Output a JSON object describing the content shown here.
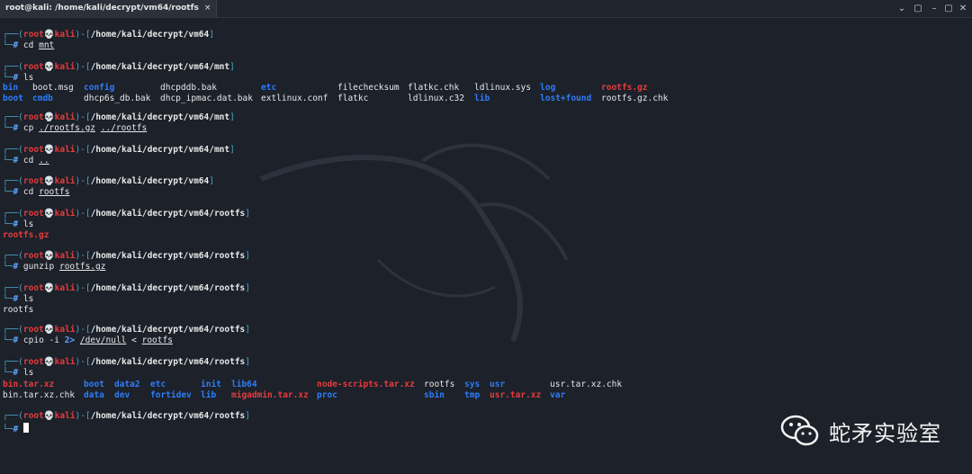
{
  "window": {
    "tab_title": "root@kali: /home/kali/decrypt/vm64/rootfs",
    "tab_close": "×",
    "controls": [
      "⌄",
      "▢",
      "–",
      "▢",
      "✕"
    ]
  },
  "prompt": {
    "user": "root",
    "host": "kali",
    "skull": "💀",
    "corner_top": "┌──(",
    "corner_bottom": "└─",
    "hash": "#"
  },
  "blocks": [
    {
      "path": "/home/kali/decrypt/vm64",
      "cmd": "cd",
      "args": [
        "mnt"
      ]
    },
    {
      "path": "/home/kali/decrypt/vm64/mnt",
      "cmd": "ls",
      "args": []
    },
    {
      "path": "/home/kali/decrypt/vm64/mnt",
      "cmd": "cp",
      "args": [
        "./rootfs.gz",
        "../rootfs"
      ]
    },
    {
      "path": "/home/kali/decrypt/vm64/mnt",
      "cmd": "cd",
      "args": [
        ".."
      ]
    },
    {
      "path": "/home/kali/decrypt/vm64",
      "cmd": "cd",
      "args": [
        "rootfs"
      ]
    },
    {
      "path": "/home/kali/decrypt/vm64/rootfs",
      "cmd": "ls",
      "args": []
    },
    {
      "path": "/home/kali/decrypt/vm64/rootfs",
      "cmd": "gunzip",
      "args": [
        "rootfs.gz"
      ]
    },
    {
      "path": "/home/kali/decrypt/vm64/rootfs",
      "cmd": "ls",
      "args": []
    },
    {
      "path": "/home/kali/decrypt/vm64/rootfs",
      "cmd": "cpio",
      "args": [
        "-i",
        "2>",
        "/dev/null",
        "<",
        "rootfs"
      ]
    },
    {
      "path": "/home/kali/decrypt/vm64/rootfs",
      "cmd": "ls",
      "args": []
    },
    {
      "path": "/home/kali/decrypt/vm64/rootfs",
      "cmd": "",
      "args": []
    }
  ],
  "ls_mnt": [
    [
      "bin",
      "blue"
    ],
    [
      "boot.msg",
      "white"
    ],
    [
      "config",
      "blue"
    ],
    [
      "dhcpddb.bak",
      "white"
    ],
    [
      "etc",
      "blue"
    ],
    [
      "filechecksum",
      "white"
    ],
    [
      "flatkc.chk",
      "white"
    ],
    [
      "ldlinux.sys",
      "white"
    ],
    [
      "log",
      "blue"
    ],
    [
      "rootfs.gz",
      "red"
    ],
    [
      "boot",
      "blue"
    ],
    [
      "cmdb",
      "blue"
    ],
    [
      "dhcp6s_db.bak",
      "white"
    ],
    [
      "dhcp_ipmac.dat.bak",
      "white"
    ],
    [
      "extlinux.conf",
      "white"
    ],
    [
      "flatkc",
      "white"
    ],
    [
      "ldlinux.c32",
      "white"
    ],
    [
      "lib",
      "blue"
    ],
    [
      "lost+found",
      "blue"
    ],
    [
      "rootfs.gz.chk",
      "white"
    ]
  ],
  "ls_rootfs1": [
    [
      "rootfs.gz",
      "red"
    ]
  ],
  "ls_rootfs2": [
    [
      "rootfs",
      "white"
    ]
  ],
  "ls_rootfs3": [
    [
      "bin.tar.xz",
      "red"
    ],
    [
      "boot",
      "blue"
    ],
    [
      "data2",
      "blue"
    ],
    [
      "etc",
      "blue"
    ],
    [
      "init",
      "blue"
    ],
    [
      "lib64",
      "blue"
    ],
    [
      "node-scripts.tar.xz",
      "red"
    ],
    [
      "rootfs",
      "white"
    ],
    [
      "sys",
      "blue"
    ],
    [
      "usr",
      "blue"
    ],
    [
      "usr.tar.xz.chk",
      "white"
    ],
    [
      "bin.tar.xz.chk",
      "white"
    ],
    [
      "data",
      "blue"
    ],
    [
      "dev",
      "blue"
    ],
    [
      "fortidev",
      "blue"
    ],
    [
      "lib",
      "blue"
    ],
    [
      "migadmin.tar.xz",
      "red"
    ],
    [
      "proc",
      "blue"
    ],
    [
      "sbin",
      "blue"
    ],
    [
      "tmp",
      "blue"
    ],
    [
      "usr.tar.xz",
      "red"
    ],
    [
      "var",
      "blue"
    ]
  ],
  "watermark": {
    "text": "蛇矛实验室",
    "icon": "wechat-icon"
  },
  "colors": {
    "background": "#1c212a",
    "blue": "#2f7cf6",
    "red": "#e63c3c",
    "teal": "#4aa6c9"
  }
}
